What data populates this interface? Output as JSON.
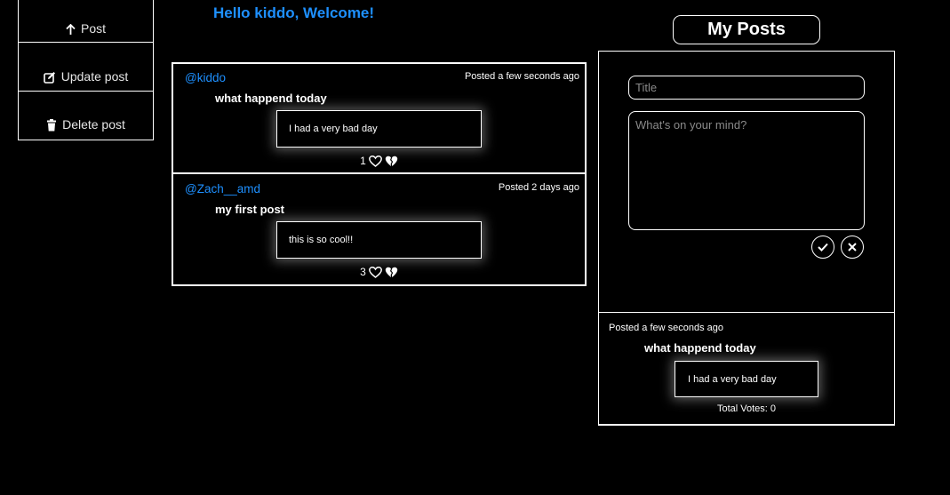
{
  "sidebar": {
    "items": [
      {
        "label": "Post",
        "icon": "arrow-up-icon"
      },
      {
        "label": "Update post",
        "icon": "edit-icon"
      },
      {
        "label": "Delete post",
        "icon": "trash-icon"
      }
    ]
  },
  "header": {
    "welcome": "Hello kiddo, Welcome!"
  },
  "feed": {
    "posts": [
      {
        "author": "@kiddo",
        "posted": "Posted a few seconds ago",
        "title": "what happend today",
        "body": "I had a very bad day",
        "votes": "1"
      },
      {
        "author": "@Zach__amd",
        "posted": "Posted 2 days ago",
        "title": "my first post",
        "body": "this is so cool!!",
        "votes": "3"
      }
    ]
  },
  "my_posts": {
    "heading": "My Posts",
    "form": {
      "title_placeholder": "Title",
      "body_placeholder": "What's on your mind?"
    },
    "posts": [
      {
        "posted": "Posted a few seconds ago",
        "title": "what happend today",
        "body": "I had a very bad day",
        "total_votes": "Total Votes: 0"
      }
    ]
  },
  "colors": {
    "background": "#000000",
    "accent": "#1e90ff",
    "border": "#ffffff"
  }
}
